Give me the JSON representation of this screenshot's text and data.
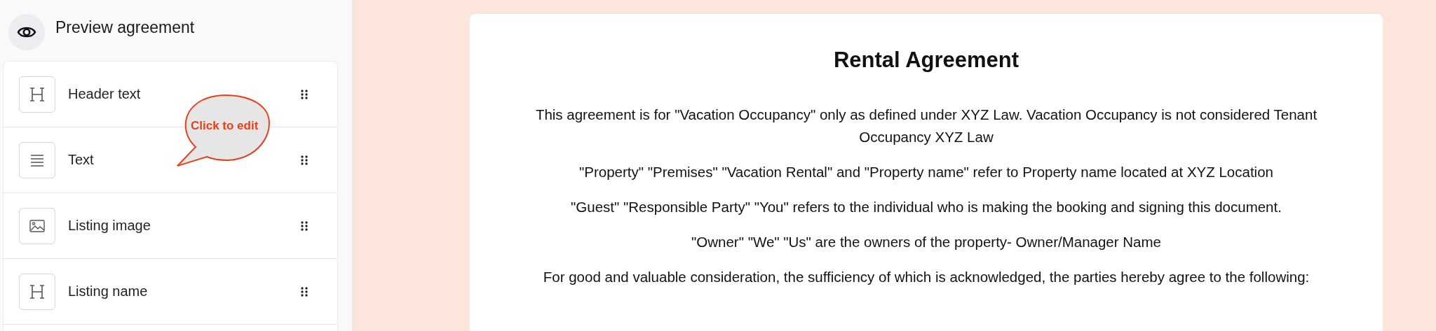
{
  "sidebar": {
    "title": "Preview agreement",
    "blocks": [
      {
        "kind": "heading",
        "label": "Header text"
      },
      {
        "kind": "text",
        "label": "Text"
      },
      {
        "kind": "image",
        "label": "Listing image"
      },
      {
        "kind": "heading",
        "label": "Listing name"
      }
    ],
    "callout": {
      "text": "Click to edit"
    }
  },
  "document": {
    "title": "Rental Agreement",
    "paragraphs": [
      "This agreement is for \"Vacation Occupancy\" only as defined under XYZ Law. Vacation Occupancy is not considered Tenant Occupancy XYZ Law",
      "\"Property\" \"Premises\" \"Vacation Rental\" and \"Property name\" refer to Property name located at XYZ Location",
      "\"Guest\" \"Responsible Party\" \"You\" refers to the individual who is making the booking and signing this document.",
      "\"Owner\" \"We\" \"Us\" are the owners of the property- Owner/Manager Name",
      "For good and valuable consideration, the sufficiency of which is acknowledged, the parties hereby agree to the following:"
    ]
  }
}
